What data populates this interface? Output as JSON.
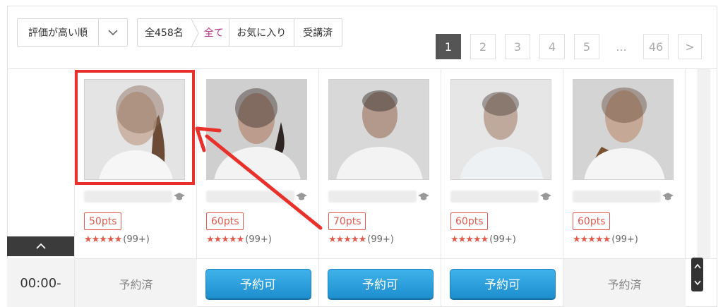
{
  "toolbar": {
    "sort_label": "評価が高い順",
    "total_label": "全458名",
    "tabs": [
      {
        "label": "全て",
        "active": true
      },
      {
        "label": "お気に入り",
        "active": false
      },
      {
        "label": "受講済",
        "active": false
      }
    ]
  },
  "pagination": {
    "pages": [
      "1",
      "2",
      "3",
      "4",
      "5"
    ],
    "current": "1",
    "ellipsis": "...",
    "last": "46",
    "next": ">"
  },
  "teachers": [
    {
      "points": "50pts",
      "stars": "★★★★★",
      "reviews": "(99+)",
      "slot": {
        "state": "booked",
        "label": "予約済"
      }
    },
    {
      "points": "60pts",
      "stars": "★★★★★",
      "reviews": "(99+)",
      "slot": {
        "state": "available",
        "label": "予約可"
      }
    },
    {
      "points": "70pts",
      "stars": "★★★★★",
      "reviews": "(99+)",
      "slot": {
        "state": "available",
        "label": "予約可"
      }
    },
    {
      "points": "60pts",
      "stars": "★★★★★",
      "reviews": "(99+)",
      "slot": {
        "state": "available",
        "label": "予約可"
      }
    },
    {
      "points": "60pts",
      "stars": "★★★★★",
      "reviews": "(99+)",
      "slot": {
        "state": "booked",
        "label": "予約済"
      }
    }
  ],
  "time_slot": "00:00-",
  "icons": {
    "sort": "chevron-down-icon",
    "collapse": "chevron-up-icon",
    "teacher_badge": "graduation-cap-icon",
    "scroll_up": "chevron-up-icon",
    "scroll_down": "chevron-down-icon"
  },
  "colors": {
    "accent_red": "#e05a4e",
    "book_blue": "#2aa0dc",
    "active_tab": "#b5328a",
    "annotation_red": "#e8312b",
    "active_page": "#555555"
  }
}
